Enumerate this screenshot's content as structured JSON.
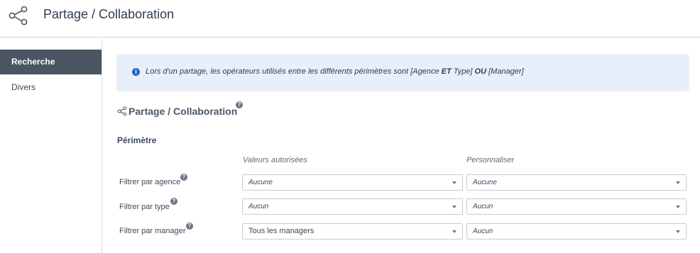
{
  "header": {
    "title": "Partage / Collaboration",
    "icon": "share-icon"
  },
  "sidebar": {
    "items": [
      {
        "label": "Recherche",
        "active": true
      },
      {
        "label": "Divers",
        "active": false
      }
    ]
  },
  "info": {
    "icon_glyph": "i",
    "text_before": "Lors d'un partage, les opérateurs utilisés entre les différents périmètres sont [Agence ",
    "and_word": "ET",
    "text_middle": " Type] ",
    "or_word": "OU",
    "text_after": " [Manager]"
  },
  "section": {
    "title": "Partage / Collaboration",
    "help_glyph": "?"
  },
  "perimetre": {
    "heading": "Périmètre",
    "columns": {
      "allowed": "Valeurs autorisées",
      "custom": "Personnaliser"
    },
    "rows": [
      {
        "label": "Filtrer par agence",
        "allowed": "Aucune",
        "custom": "Aucune"
      },
      {
        "label": "Filtrer par type",
        "allowed": "Aucun",
        "custom": "Aucun"
      },
      {
        "label": "Filtrer par manager",
        "allowed": "Tous les managers",
        "custom": "Aucun"
      }
    ]
  },
  "colors": {
    "accent": "#2962c4",
    "sidebar_active": "#4b5563",
    "info_bg": "#e7effb"
  }
}
